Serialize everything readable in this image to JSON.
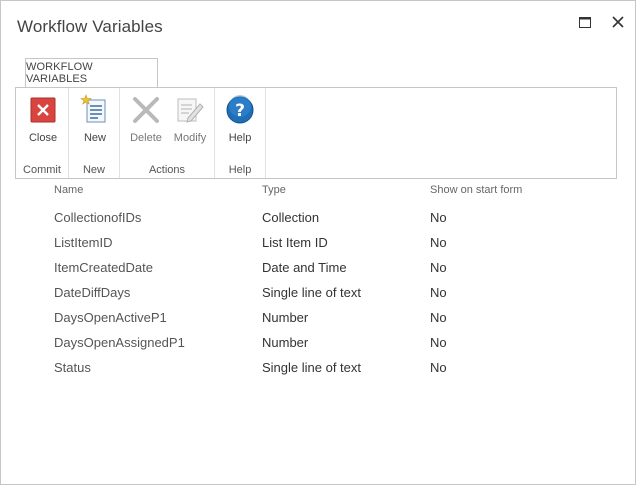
{
  "dialog": {
    "title": "Workflow Variables"
  },
  "ribbon": {
    "tab_label": "WORKFLOW VARIABLES",
    "groups": [
      {
        "label": "Commit",
        "buttons": [
          {
            "label": "Close",
            "icon": "close-icon"
          }
        ]
      },
      {
        "label": "New",
        "buttons": [
          {
            "label": "New",
            "icon": "new-item-icon"
          }
        ]
      },
      {
        "label": "Actions",
        "buttons": [
          {
            "label": "Delete",
            "icon": "delete-icon"
          },
          {
            "label": "Modify",
            "icon": "modify-icon"
          }
        ]
      },
      {
        "label": "Help",
        "buttons": [
          {
            "label": "Help",
            "icon": "help-icon"
          }
        ]
      }
    ]
  },
  "table": {
    "headers": [
      "Name",
      "Type",
      "Show on start form"
    ],
    "rows": [
      {
        "name": "CollectionofIDs",
        "type": "Collection",
        "show": "No"
      },
      {
        "name": "ListItemID",
        "type": "List Item ID",
        "show": "No"
      },
      {
        "name": "ItemCreatedDate",
        "type": "Date and Time",
        "show": "No"
      },
      {
        "name": "DateDiffDays",
        "type": "Single line of text",
        "show": "No"
      },
      {
        "name": "DaysOpenActiveP1",
        "type": "Number",
        "show": "No"
      },
      {
        "name": "DaysOpenAssignedP1",
        "type": "Number",
        "show": "No"
      },
      {
        "name": "Status",
        "type": "Single line of text",
        "show": "No"
      }
    ]
  },
  "colors": {
    "close_red": "#d9443f",
    "help_blue": "#1e6fb8",
    "border": "#c6c6c6"
  }
}
